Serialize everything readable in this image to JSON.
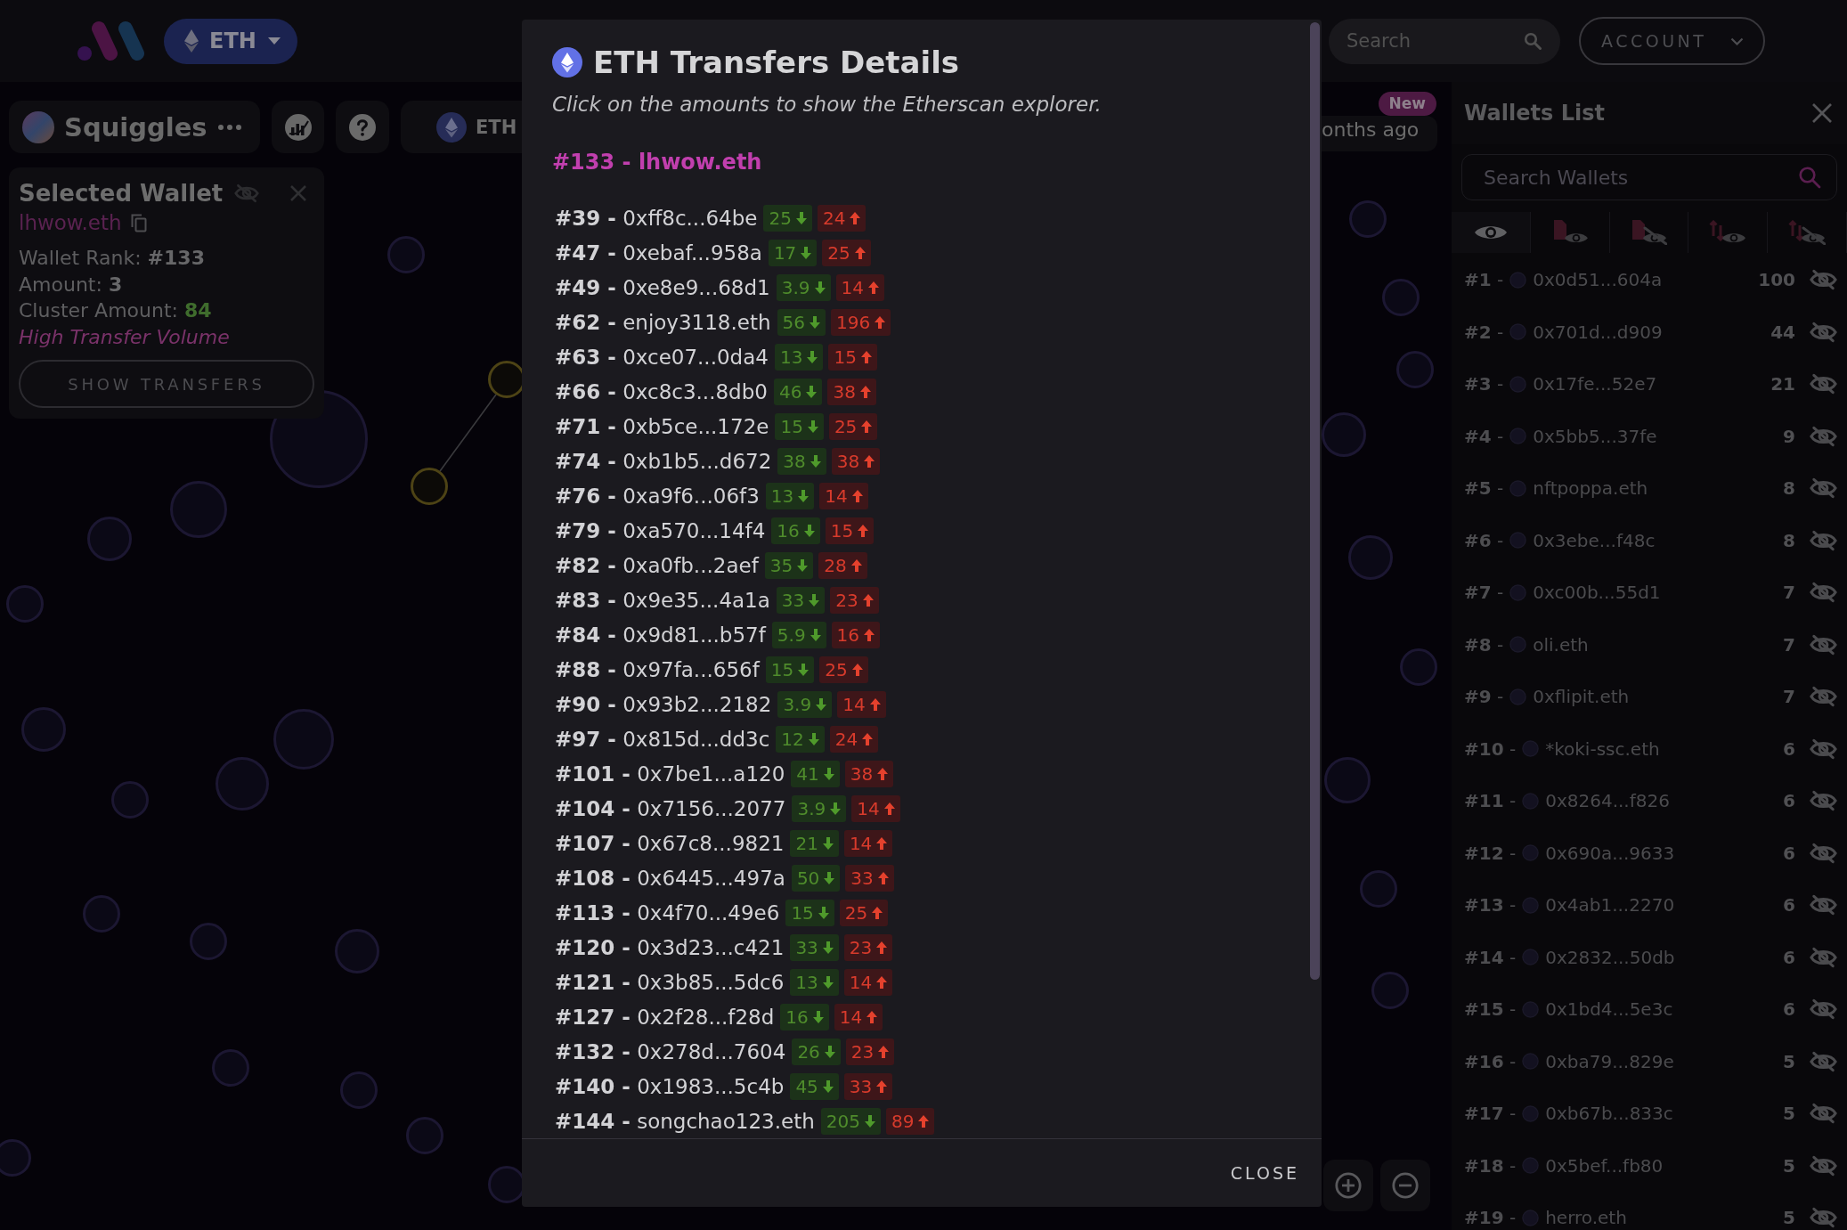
{
  "header": {
    "network": {
      "label": "ETH"
    },
    "search": {
      "placeholder": "Search"
    },
    "account": {
      "label": "ACCOUNT"
    }
  },
  "toolbar": {
    "collection": {
      "name": "Squiggles"
    },
    "network": {
      "label": "ETH"
    },
    "news": {
      "badge": "New",
      "text": "onths ago"
    }
  },
  "selected_wallet": {
    "title": "Selected Wallet",
    "wallet": "lhwow.eth",
    "stats": [
      {
        "kind": "neutral",
        "label": "Wallet Rank:",
        "value": "#133"
      },
      {
        "kind": "neutral",
        "label": "Amount:",
        "value": "3"
      },
      {
        "kind": "positive",
        "label": "Cluster Amount:",
        "value": "84"
      }
    ],
    "tag": "High Transfer Volume",
    "button": "SHOW TRANSFERS"
  },
  "transfers_dialog": {
    "title": "ETH Transfers Details",
    "subtitle": "Click on the amounts to show the Etherscan explorer.",
    "heading": "#133 - lhwow.eth",
    "transfers": [
      {
        "wallet": "**#39 -** 0xff8c...64be",
        "received": "25",
        "sent": "24"
      },
      {
        "wallet": "**#47 -** 0xebaf...958a",
        "received": "17",
        "sent": "25"
      },
      {
        "wallet": "**#49 -** 0xe8e9...68d1",
        "received": "3.9",
        "sent": "14"
      },
      {
        "wallet": "**#62 -** enjoy3118.eth",
        "received": "56",
        "sent": "196"
      },
      {
        "wallet": "**#63 -** 0xce07...0da4",
        "received": "13",
        "sent": "15"
      },
      {
        "wallet": "**#66 -** 0xc8c3...8db0",
        "received": "46",
        "sent": "38"
      },
      {
        "wallet": "**#71 -** 0xb5ce...172e",
        "received": "15",
        "sent": "25"
      },
      {
        "wallet": "**#74 -** 0xb1b5...d672",
        "received": "38",
        "sent": "38"
      },
      {
        "wallet": "**#76 -** 0xa9f6...06f3",
        "received": "13",
        "sent": "14"
      },
      {
        "wallet": "**#79 -** 0xa570...14f4",
        "received": "16",
        "sent": "15"
      },
      {
        "wallet": "**#82 -** 0xa0fb...2aef",
        "received": "35",
        "sent": "28"
      },
      {
        "wallet": "**#83 -** 0x9e35...4a1a",
        "received": "33",
        "sent": "23"
      },
      {
        "wallet": "**#84 -** 0x9d81...b57f",
        "received": "5.9",
        "sent": "16"
      },
      {
        "wallet": "**#88 -** 0x97fa...656f",
        "received": "15",
        "sent": "25"
      },
      {
        "wallet": "**#90 -** 0x93b2...2182",
        "received": "3.9",
        "sent": "14"
      },
      {
        "wallet": "**#97 -** 0x815d...dd3c",
        "received": "12",
        "sent": "24"
      },
      {
        "wallet": "**#101 -** 0x7be1...a120",
        "received": "41",
        "sent": "38"
      },
      {
        "wallet": "**#104 -** 0x7156...2077",
        "received": "3.9",
        "sent": "14"
      },
      {
        "wallet": "**#107 -** 0x67c8...9821",
        "received": "21",
        "sent": "14"
      },
      {
        "wallet": "**#108 -** 0x6445...497a",
        "received": "50",
        "sent": "33"
      },
      {
        "wallet": "**#113 -** 0x4f70...49e6",
        "received": "15",
        "sent": "25"
      },
      {
        "wallet": "**#120 -** 0x3d23...c421",
        "received": "33",
        "sent": "23"
      },
      {
        "wallet": "**#121 -** 0x3b85...5dc6",
        "received": "13",
        "sent": "14"
      },
      {
        "wallet": "**#127 -** 0x2f28...f28d",
        "received": "16",
        "sent": "14"
      },
      {
        "wallet": "**#132 -** 0x278d...7604",
        "received": "26",
        "sent": "23"
      },
      {
        "wallet": "**#140 -** 0x1983...5c4b",
        "received": "45",
        "sent": "33"
      },
      {
        "wallet": "**#144 -** songchao123.eth",
        "received": "205",
        "sent": "89"
      }
    ],
    "close_button": "CLOSE"
  },
  "wallets_list": {
    "title": "Wallets List",
    "search": {
      "placeholder": "Search Wallets"
    },
    "filters": [
      {
        "kind": "eye",
        "selected": true
      },
      {
        "kind": "docshown",
        "selected": false
      },
      {
        "kind": "dochidden",
        "selected": false
      },
      {
        "kind": "swapshown",
        "selected": false
      },
      {
        "kind": "swaphidden",
        "selected": false
      }
    ],
    "wallets": [
      {
        "rank": "**#1** -",
        "address": "0x0d51...604a",
        "amount": "100"
      },
      {
        "rank": "**#2** -",
        "address": "0x701d...d909",
        "amount": "44"
      },
      {
        "rank": "**#3** -",
        "address": "0x17fe...52e7",
        "amount": "21"
      },
      {
        "rank": "**#4** -",
        "address": "0x5bb5...37fe",
        "amount": "9"
      },
      {
        "rank": "**#5** -",
        "address": "nftpoppa.eth",
        "amount": "8"
      },
      {
        "rank": "**#6** -",
        "address": "0x3ebe...f48c",
        "amount": "8"
      },
      {
        "rank": "**#7** -",
        "address": "0xc00b...55d1",
        "amount": "7"
      },
      {
        "rank": "**#8** -",
        "address": "oli.eth",
        "amount": "7"
      },
      {
        "rank": "**#9** -",
        "address": "0xflipit.eth",
        "amount": "7"
      },
      {
        "rank": "**#10** -",
        "address": "*koki-ssc.eth",
        "amount": "6"
      },
      {
        "rank": "**#11** -",
        "address": "0x8264...f826",
        "amount": "6"
      },
      {
        "rank": "**#12** -",
        "address": "0x690a...9633",
        "amount": "6"
      },
      {
        "rank": "**#13** -",
        "address": "0x4ab1...2270",
        "amount": "6"
      },
      {
        "rank": "**#14** -",
        "address": "0x2832...50db",
        "amount": "6"
      },
      {
        "rank": "**#15** -",
        "address": "0x1bd4...5e3c",
        "amount": "6"
      },
      {
        "rank": "**#16** -",
        "address": "0xba79...829e",
        "amount": "5"
      },
      {
        "rank": "**#17** -",
        "address": "0xb67b...833c",
        "amount": "5"
      },
      {
        "rank": "**#18** -",
        "address": "0x5bef...fb80",
        "amount": "5"
      },
      {
        "rank": "**#19** -",
        "address": "herro.eth",
        "amount": "5"
      }
    ]
  }
}
